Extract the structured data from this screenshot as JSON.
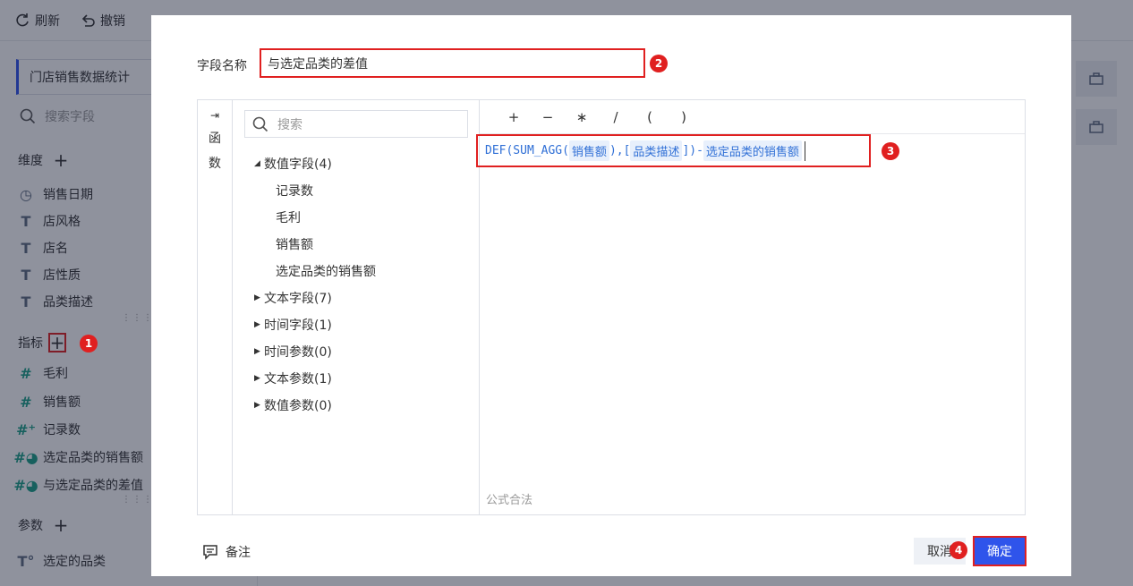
{
  "toolbar": {
    "refresh_label": "刷新",
    "undo_label": "撤销"
  },
  "left_panel": {
    "dataset_name": "门店销售数据统计",
    "search_placeholder": "搜索字段",
    "dimensions": {
      "title": "维度",
      "items": [
        {
          "label": "销售日期",
          "icon": "clock-icon"
        },
        {
          "label": "店风格",
          "icon": "text-type-icon"
        },
        {
          "label": "店名",
          "icon": "text-type-icon"
        },
        {
          "label": "店性质",
          "icon": "text-type-icon"
        },
        {
          "label": "品类描述",
          "icon": "text-type-icon"
        }
      ]
    },
    "measures": {
      "title": "指标",
      "items": [
        {
          "label": "毛利",
          "icon": "number-icon"
        },
        {
          "label": "销售额",
          "icon": "number-icon"
        },
        {
          "label": "记录数",
          "icon": "count-number-icon"
        },
        {
          "label": "选定品类的销售额",
          "icon": "calc-number-icon"
        },
        {
          "label": "与选定品类的差值",
          "icon": "calc-number-icon"
        }
      ]
    },
    "params": {
      "title": "参数",
      "items": [
        {
          "label": "选定的品类",
          "icon": "text-param-icon"
        }
      ]
    }
  },
  "markers": [
    "1",
    "2",
    "3",
    "4"
  ],
  "modal": {
    "field_name_label": "字段名称",
    "field_name_value": "与选定品类的差值",
    "function_rail_label": [
      "函",
      "数"
    ],
    "tree_search_placeholder": "搜索",
    "tree": [
      {
        "label": "数值字段(4)",
        "expanded": true,
        "children": [
          "记录数",
          "毛利",
          "销售额",
          "选定品类的销售额"
        ]
      },
      {
        "label": "文本字段(7)",
        "expanded": false
      },
      {
        "label": "时间字段(1)",
        "expanded": false
      },
      {
        "label": "时间参数(0)",
        "expanded": false
      },
      {
        "label": "文本参数(1)",
        "expanded": false
      },
      {
        "label": "数值参数(0)",
        "expanded": false
      }
    ],
    "operators": [
      "+",
      "−",
      "∗",
      "/",
      "(",
      ")"
    ],
    "formula": {
      "p1": "DEF(SUM_AGG(",
      "chip1": "销售额",
      "p2": "),[",
      "chip2": "品类描述",
      "p3": "])-",
      "chip3": "选定品类的销售额"
    },
    "validation_text": "公式合法",
    "remark_label": "备注",
    "cancel_label": "取消",
    "ok_label": "确定"
  }
}
